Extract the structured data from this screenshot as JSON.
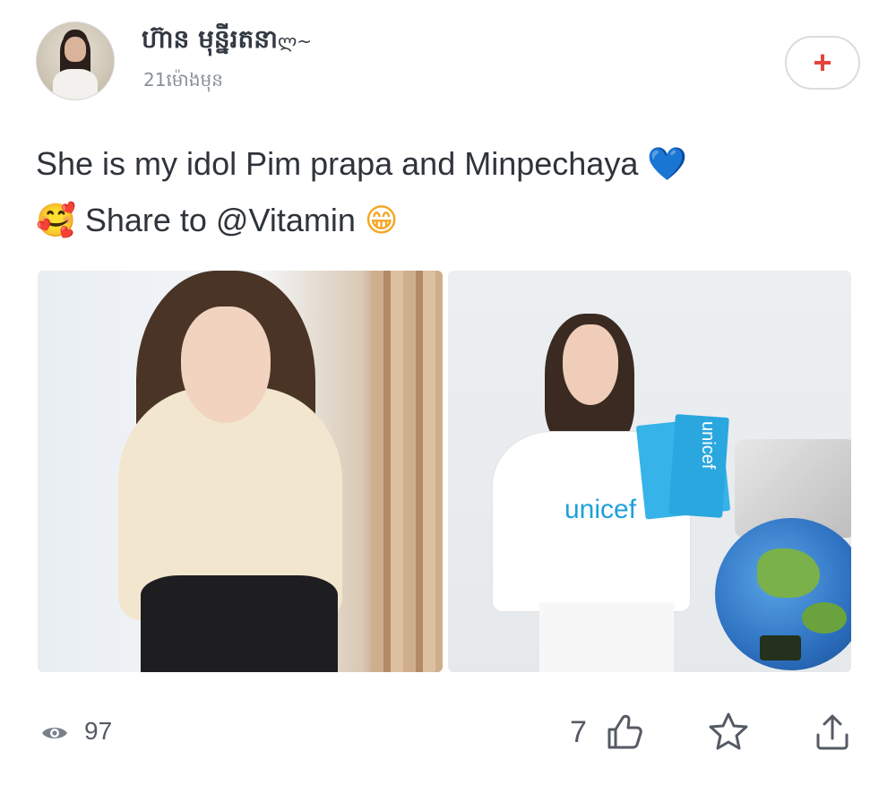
{
  "post": {
    "author_name": "ហ៊ាន មុន្នីរតនា",
    "author_flourish": "ლ~",
    "timestamp": "21ម៉ោងមុន",
    "follow_label": "+",
    "text_line1": "She is my idol Pim prapa and Minpechaya",
    "text_line2": "Share to @Vitamin",
    "emoji_heart": "💙",
    "emoji_hug": "🥰",
    "emoji_grin": "😁"
  },
  "images": [
    {
      "subject": "photo-woman-sweater"
    },
    {
      "subject": "photo-woman-unicef",
      "shirt_text": "unicef",
      "card_text": "unicef"
    }
  ],
  "stats": {
    "views": "97",
    "likes": "7"
  },
  "colors": {
    "accent": "#e5443c",
    "text": "#2f343b",
    "muted": "#8a8f98",
    "heart": "#1e88e5"
  },
  "icons": [
    "eye-icon",
    "thumbs-up-icon",
    "star-icon",
    "share-upload-icon",
    "plus-icon"
  ]
}
